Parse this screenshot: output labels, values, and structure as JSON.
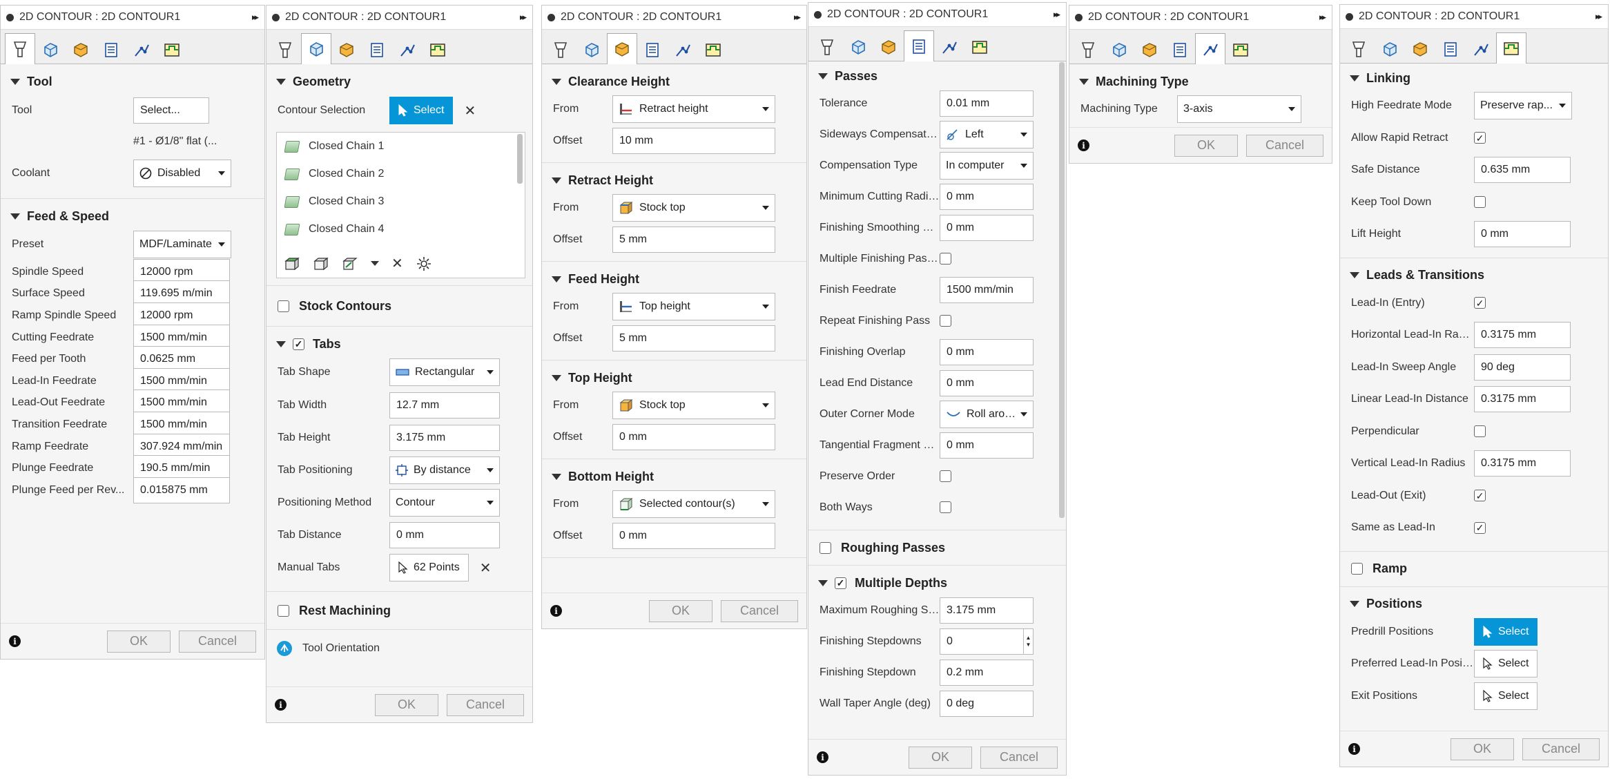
{
  "title": "2D CONTOUR : 2D CONTOUR1",
  "expand_glyph": "▸▸",
  "ok_label": "OK",
  "cancel_label": "Cancel",
  "info_glyph": "i",
  "tool_panel": {
    "tool_header": "Tool",
    "tool_label": "Tool",
    "tool_button": "Select...",
    "tool_desc": "#1 - Ø1/8\" flat (...",
    "coolant_label": "Coolant",
    "coolant_value": "Disabled",
    "feed_header": "Feed & Speed",
    "preset_label": "Preset",
    "preset_value": "MDF/Laminate",
    "rows": [
      {
        "label": "Spindle Speed",
        "value": "12000 rpm"
      },
      {
        "label": "Surface Speed",
        "value": "119.695 m/min"
      },
      {
        "label": "Ramp Spindle Speed",
        "value": "12000 rpm"
      },
      {
        "label": "Cutting Feedrate",
        "value": "1500 mm/min"
      },
      {
        "label": "Feed per Tooth",
        "value": "0.0625 mm"
      },
      {
        "label": "Lead-In Feedrate",
        "value": "1500 mm/min"
      },
      {
        "label": "Lead-Out Feedrate",
        "value": "1500 mm/min"
      },
      {
        "label": "Transition Feedrate",
        "value": "1500 mm/min"
      },
      {
        "label": "Ramp Feedrate",
        "value": "307.924 mm/min"
      },
      {
        "label": "Plunge Feedrate",
        "value": "190.5 mm/min"
      },
      {
        "label": "Plunge Feed per Rev...",
        "value": "0.015875 mm"
      }
    ]
  },
  "geometry_panel": {
    "geometry_header": "Geometry",
    "contour_label": "Contour Selection",
    "select_label": "Select",
    "chains": [
      "Closed Chain 1",
      "Closed Chain 2",
      "Closed Chain 3",
      "Closed Chain 4"
    ],
    "stock_contours": "Stock Contours",
    "tabs_header": "Tabs",
    "tab_shape_label": "Tab Shape",
    "tab_shape_value": "Rectangular",
    "tab_width_label": "Tab Width",
    "tab_width_value": "12.7 mm",
    "tab_height_label": "Tab Height",
    "tab_height_value": "3.175 mm",
    "tab_pos_label": "Tab Positioning",
    "tab_pos_value": "By distance",
    "pos_method_label": "Positioning Method",
    "pos_method_value": "Contour",
    "tab_dist_label": "Tab Distance",
    "tab_dist_value": "0 mm",
    "manual_label": "Manual Tabs",
    "manual_value": "62 Points",
    "rest_machining": "Rest Machining",
    "tool_orientation": "Tool Orientation"
  },
  "heights_panel": {
    "from_label": "From",
    "offset_label": "Offset",
    "sections": [
      {
        "header": "Clearance Height",
        "from": "Retract height",
        "offset": "10 mm"
      },
      {
        "header": "Retract Height",
        "from": "Stock top",
        "offset": "5 mm"
      },
      {
        "header": "Feed Height",
        "from": "Top height",
        "offset": "5 mm"
      },
      {
        "header": "Top Height",
        "from": "Stock top",
        "offset": "0 mm"
      },
      {
        "header": "Bottom Height",
        "from": "Selected contour(s)",
        "offset": "0 mm"
      }
    ]
  },
  "passes_panel": {
    "passes_header": "Passes",
    "rows": [
      {
        "label": "Tolerance",
        "type": "input",
        "value": "0.01 mm"
      },
      {
        "label": "Sideways Compensation",
        "type": "dropdown",
        "value": "Left",
        "icon": "left"
      },
      {
        "label": "Compensation Type",
        "type": "dropdown",
        "value": "In computer"
      },
      {
        "label": "Minimum Cutting Radius",
        "type": "input",
        "value": "0 mm"
      },
      {
        "label": "Finishing Smoothing Deviation",
        "type": "input",
        "value": "0 mm"
      },
      {
        "label": "Multiple Finishing Passes",
        "type": "check",
        "value": ""
      },
      {
        "label": "Finish Feedrate",
        "type": "input",
        "value": "1500 mm/min"
      },
      {
        "label": "Repeat Finishing Pass",
        "type": "check",
        "value": ""
      },
      {
        "label": "Finishing Overlap",
        "type": "input",
        "value": "0 mm"
      },
      {
        "label": "Lead End Distance",
        "type": "input",
        "value": "0 mm"
      },
      {
        "label": "Outer Corner Mode",
        "type": "dropdown",
        "value": "Roll arou...",
        "icon": "roll"
      },
      {
        "label": "Tangential Fragment Extension",
        "type": "input",
        "value": "0 mm"
      },
      {
        "label": "Preserve Order",
        "type": "check",
        "value": ""
      },
      {
        "label": "Both Ways",
        "type": "check",
        "value": ""
      }
    ],
    "roughing_header": "Roughing Passes",
    "depths_header": "Multiple Depths",
    "depth_rows": [
      {
        "label": "Maximum Roughing Stepdown",
        "value": "3.175 mm"
      },
      {
        "label": "Finishing Stepdowns",
        "value": "0"
      },
      {
        "label": "Finishing Stepdown",
        "value": "0.2 mm"
      },
      {
        "label": "Wall Taper Angle (deg)",
        "value": "0 deg"
      }
    ]
  },
  "machining_panel": {
    "header": "Machining Type",
    "label": "Machining Type",
    "value": "3-axis"
  },
  "linking_panel": {
    "linking_header": "Linking",
    "hf_label": "High Feedrate Mode",
    "hf_value": "Preserve rap...",
    "allow_rapid": "Allow Rapid Retract",
    "safe_label": "Safe Distance",
    "safe_value": "0.635 mm",
    "keep_down": "Keep Tool Down",
    "lift_label": "Lift Height",
    "lift_value": "0 mm",
    "leads_header": "Leads & Transitions",
    "lead_in": "Lead-In (Entry)",
    "h_radius_label": "Horizontal Lead-In Radius",
    "h_radius_value": "0.3175 mm",
    "sweep_label": "Lead-In Sweep Angle",
    "sweep_value": "90 deg",
    "linear_label": "Linear Lead-In Distance",
    "linear_value": "0.3175 mm",
    "perpendicular": "Perpendicular",
    "v_radius_label": "Vertical Lead-In Radius",
    "v_radius_value": "0.3175 mm",
    "lead_out": "Lead-Out (Exit)",
    "same_as": "Same as Lead-In",
    "ramp_header": "Ramp",
    "positions_header": "Positions",
    "predrill_label": "Predrill Positions",
    "pref_label": "Preferred Lead-In Positions",
    "exit_label": "Exit Positions",
    "select_label": "Select"
  },
  "check_glyph": "✓"
}
